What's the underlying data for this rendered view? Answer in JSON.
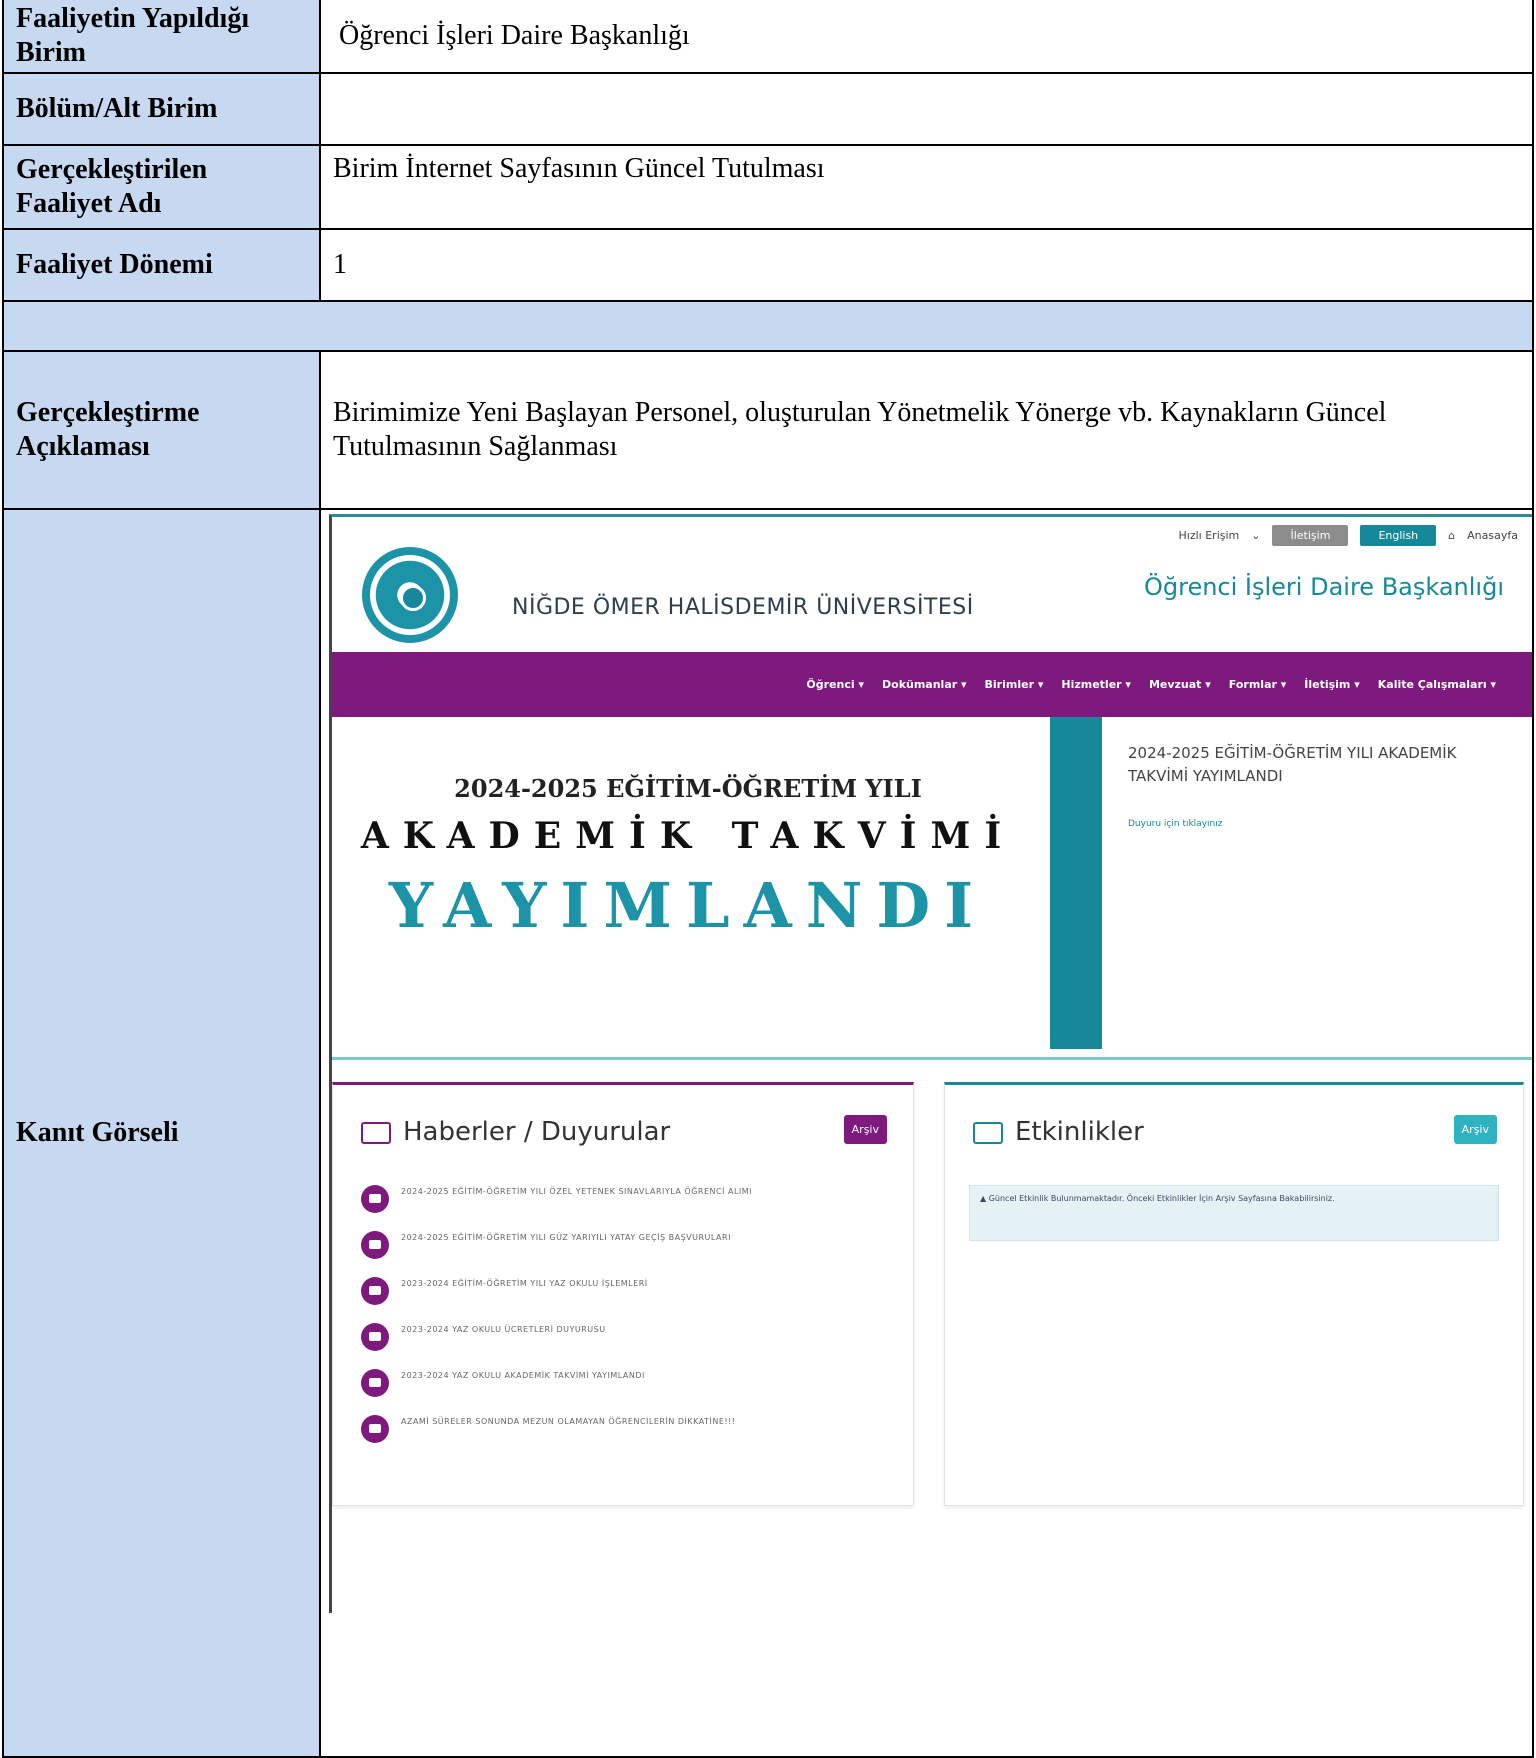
{
  "form": {
    "rows": [
      {
        "label": "Faaliyetin Yapıldığı Birim",
        "value": "Öğrenci İşleri Daire Başkanlığı"
      },
      {
        "label": "Bölüm/Alt Birim",
        "value": ""
      },
      {
        "label": "Gerçekleştirilen Faaliyet Adı",
        "value": "Birim İnternet Sayfasının Güncel Tutulması"
      },
      {
        "label": "Faaliyet Dönemi",
        "value": "1"
      },
      {
        "label": "Gerçekleştirme Açıklaması",
        "value": "Birimimize Yeni Başlayan Personel, oluşturulan Yönetmelik Yönerge vb. Kaynakların Güncel Tutulmasının Sağlanması"
      },
      {
        "label": "Kanıt Görseli",
        "value": ""
      }
    ]
  },
  "evidence": {
    "topbar": {
      "quick": "Hızlı Erişim",
      "contact": "İletişim",
      "english": "English",
      "home": "Anasayfa"
    },
    "university": "NİĞDE ÖMER HALİSDEMİR ÜNİVERSİTESİ",
    "site_title": "Öğrenci İşleri Daire Başkanlığı",
    "nav": [
      "Öğrenci ▾",
      "Dokümanlar ▾",
      "Birimler ▾",
      "Hizmetler ▾",
      "Mevzuat ▾",
      "Formlar ▾",
      "İletişim ▾",
      "Kalite Çalışmaları ▾"
    ],
    "hero": {
      "line1": "2024-2025 EĞİTİM-ÖĞRETİM YILI",
      "line2": "AKADEMİK TAKVİMİ",
      "line3": "YAYIMLANDI",
      "side_title": "2024-2025 EĞİTİM-ÖĞRETİM YILI AKADEMİK TAKVİMİ YAYIMLANDI",
      "side_link": "Duyuru için tıklayınız"
    },
    "news": {
      "title": "Haberler / Duyurular",
      "archive": "Arşiv",
      "items": [
        "2024-2025 EĞİTİM-ÖĞRETİM YILI ÖZEL YETENEK SINAVLARIYLA ÖĞRENCİ ALIMI",
        "2024-2025 EĞİTİM-ÖĞRETİM YILI GÜZ YARIYILI YATAY GEÇİŞ BAŞVURULARI",
        "2023-2024 EĞİTİM-ÖĞRETİM YILI YAZ OKULU İŞLEMLERİ",
        "2023-2024 YAZ OKULU ÜCRETLERİ DUYURUSU",
        "2023-2024 YAZ OKULU AKADEMİK TAKVİMİ YAYIMLANDI",
        "AZAMİ SÜRELER SONUNDA MEZUN OLAMAYAN ÖĞRENCİLERİN DİKKATİNE!!!"
      ]
    },
    "events": {
      "title": "Etkinlikler",
      "archive": "Arşiv",
      "notice": "Güncel Etkinlik Bulunmamaktadır. Önceki Etkinlikler İçin Arşiv Sayfasına Bakabilirsiniz."
    }
  }
}
